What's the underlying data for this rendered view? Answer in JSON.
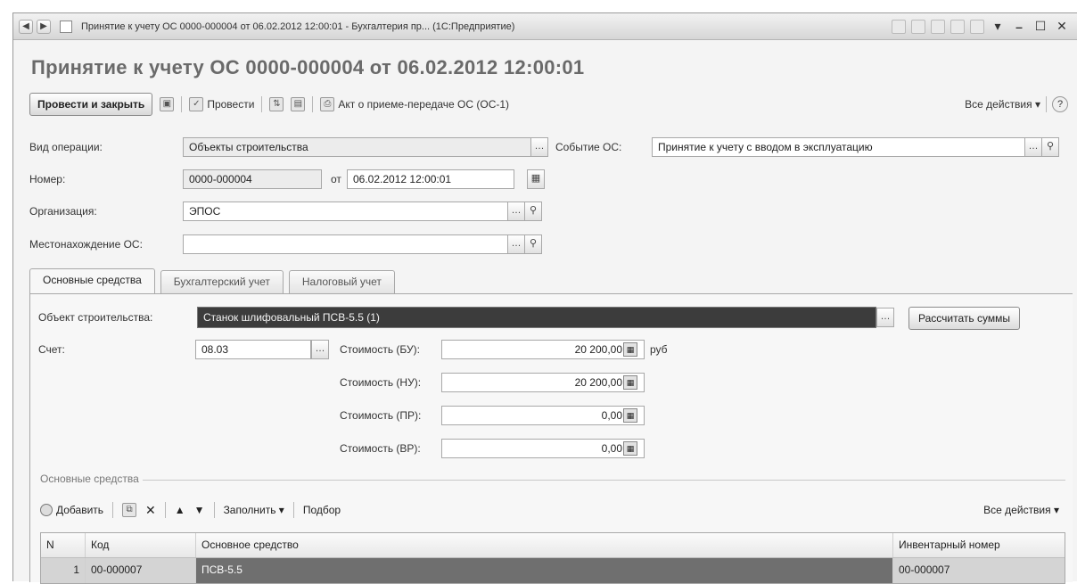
{
  "window": {
    "title": "Принятие к учету ОС 0000-000004 от 06.02.2012 12:00:01 - Бухгалтерия пр... (1С:Предприятие)"
  },
  "document": {
    "title": "Принятие к учету ОС 0000-000004 от 06.02.2012 12:00:01"
  },
  "toolbar": {
    "post_and_close": "Провести и закрыть",
    "post": "Провести",
    "act": "Акт о приеме-передаче ОС (ОС-1)",
    "all_actions": "Все действия ▾",
    "help": "?"
  },
  "form": {
    "operation_label": "Вид операции:",
    "operation_value": "Объекты строительства",
    "event_label": "Событие ОС:",
    "event_value": "Принятие к учету с вводом в эксплуатацию",
    "number_label": "Номер:",
    "number_value": "0000-000004",
    "date_prefix": "от",
    "date_value": "06.02.2012 12:00:01",
    "org_label": "Организация:",
    "org_value": "ЭПОС",
    "location_label": "Местонахождение ОС:",
    "location_value": ""
  },
  "tabs": [
    {
      "label": "Основные средства",
      "active": true
    },
    {
      "label": "Бухгалтерский учет",
      "active": false
    },
    {
      "label": "Налоговый учет",
      "active": false
    }
  ],
  "main": {
    "object_label": "Объект строительства:",
    "object_value": "Станок шлифовальный ПСВ-5.5 (1)",
    "calc_button": "Рассчитать суммы",
    "account_label": "Счет:",
    "account_value": "08.03",
    "cost_bu_label": "Стоимость (БУ):",
    "cost_bu_value": "20 200,00",
    "currency": "руб",
    "cost_nu_label": "Стоимость (НУ):",
    "cost_nu_value": "20 200,00",
    "cost_pr_label": "Стоимость (ПР):",
    "cost_pr_value": "0,00",
    "cost_vr_label": "Стоимость (ВР):",
    "cost_vr_value": "0,00"
  },
  "assets_group": {
    "title": "Основные средства",
    "add": "Добавить",
    "fill": "Заполнить ▾",
    "pick": "Подбор",
    "all_actions": "Все действия ▾",
    "columns": [
      "N",
      "Код",
      "Основное средство",
      "Инвентарный номер"
    ],
    "rows": [
      {
        "n": "1",
        "kod": "00-000007",
        "asset": "ПСВ-5.5",
        "inv": "00-000007"
      }
    ]
  },
  "colors": {
    "selected_field": "#3c3c3c",
    "background": "#f4f4f4"
  }
}
